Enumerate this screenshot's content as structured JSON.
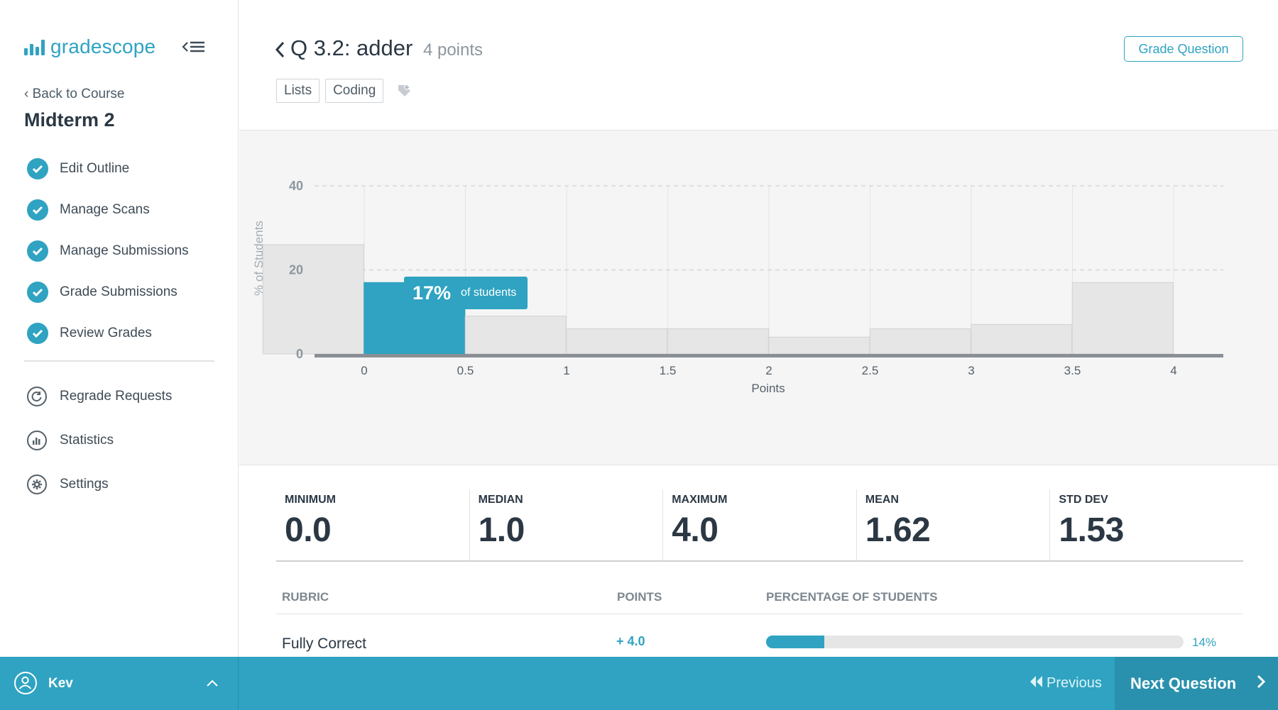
{
  "app": {
    "logo_text": "gradescope",
    "brand_color": "#2fa3c1"
  },
  "sidebar": {
    "back_label": "Back to Course",
    "course_title": "Midterm 2",
    "workflow_items": [
      {
        "label": "Edit Outline",
        "status": "complete"
      },
      {
        "label": "Manage Scans",
        "status": "complete"
      },
      {
        "label": "Manage Submissions",
        "status": "complete"
      },
      {
        "label": "Grade Submissions",
        "status": "complete"
      },
      {
        "label": "Review Grades",
        "status": "complete"
      }
    ],
    "secondary_items": [
      {
        "label": "Regrade Requests",
        "icon": "regrade-icon"
      },
      {
        "label": "Statistics",
        "icon": "statistics-icon"
      },
      {
        "label": "Settings",
        "icon": "settings-icon"
      }
    ]
  },
  "question": {
    "title": "Q 3.2: adder",
    "points": "4 points",
    "tags": [
      "Lists",
      "Coding"
    ],
    "grade_button": "Grade Question"
  },
  "chart_data": {
    "type": "bar",
    "categories": [
      "0",
      "0.5",
      "1",
      "1.5",
      "2",
      "2.5",
      "3",
      "3.5",
      "4"
    ],
    "values": [
      26,
      17,
      9,
      6,
      6,
      4,
      6,
      7,
      17
    ],
    "highlighted_index": 1,
    "xlabel": "Points",
    "ylabel": "% of Students",
    "ylim": [
      0,
      40
    ],
    "yticks": [
      0,
      20,
      40
    ],
    "grid": true,
    "tooltip": {
      "value": "17%",
      "text": "of students"
    },
    "colors": {
      "bar": "#e6e6e6",
      "highlight": "#2fa3c1"
    }
  },
  "stats": [
    {
      "label": "MINIMUM",
      "value": "0.0"
    },
    {
      "label": "MEDIAN",
      "value": "1.0"
    },
    {
      "label": "MAXIMUM",
      "value": "4.0"
    },
    {
      "label": "MEAN",
      "value": "1.62"
    },
    {
      "label": "STD DEV",
      "value": "1.53"
    }
  ],
  "rubric": {
    "headers": {
      "rubric": "RUBRIC",
      "points": "POINTS",
      "percentage": "PERCENTAGE OF STUDENTS"
    },
    "rows": [
      {
        "description": "Fully Correct",
        "points": "+ 4.0",
        "percent_label": "14%",
        "percent": 14
      }
    ]
  },
  "footer": {
    "user_name": "Kev",
    "previous_label": "Previous",
    "next_label": "Next Question"
  }
}
